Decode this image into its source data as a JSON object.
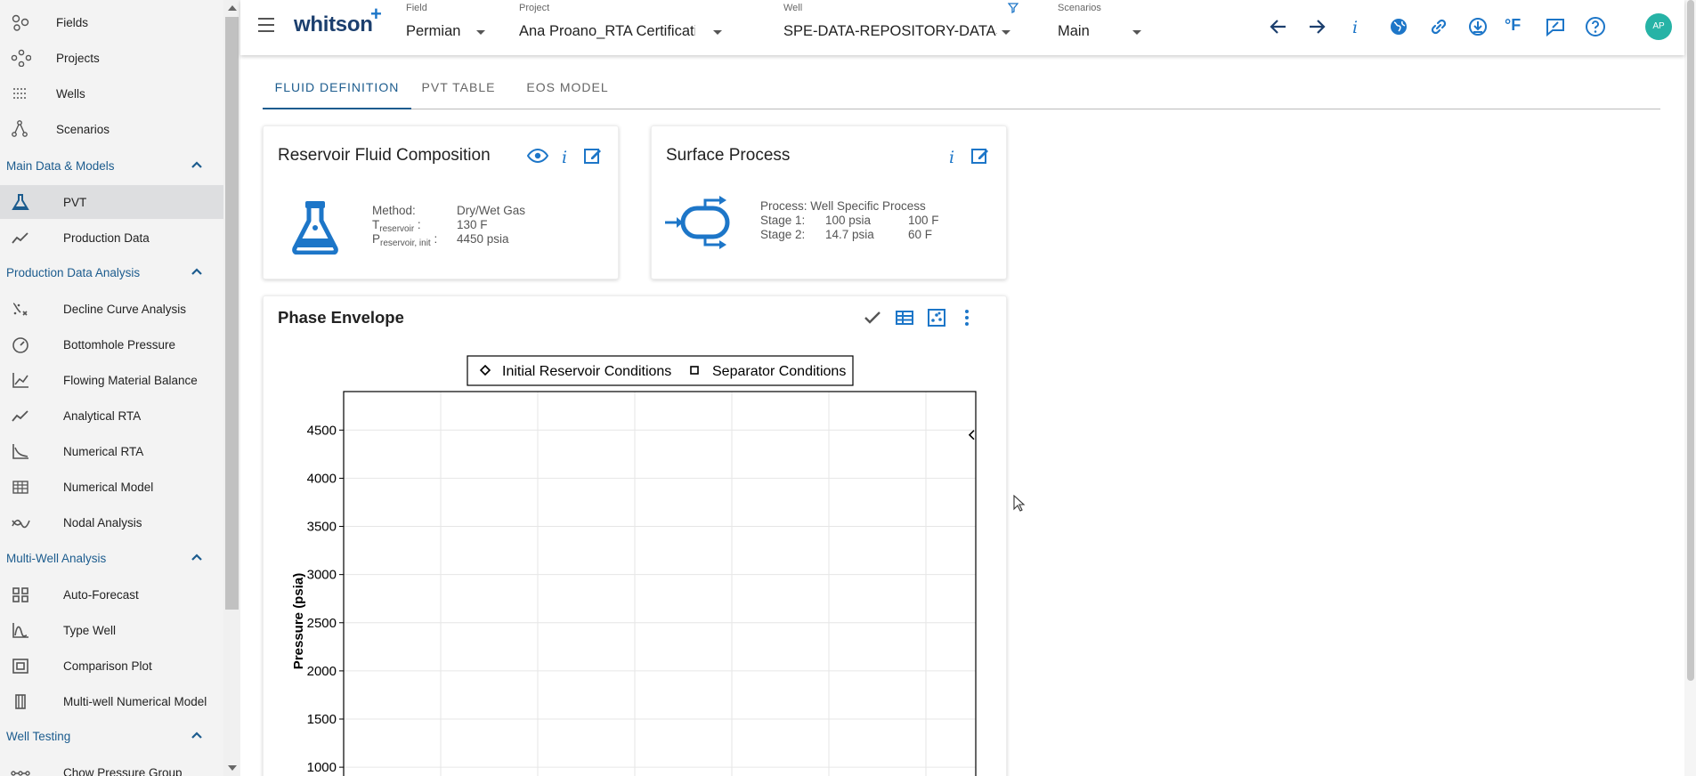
{
  "sidebar": {
    "top_items": [
      {
        "label": "Fields",
        "icon": "fields-icon"
      },
      {
        "label": "Projects",
        "icon": "projects-icon"
      },
      {
        "label": "Wells",
        "icon": "wells-icon"
      },
      {
        "label": "Scenarios",
        "icon": "scenarios-icon"
      }
    ],
    "sections": [
      {
        "label": "Main Data & Models",
        "items": [
          {
            "label": "PVT",
            "icon": "flask-icon",
            "active": true
          },
          {
            "label": "Production Data",
            "icon": "production-data-icon"
          }
        ]
      },
      {
        "label": "Production Data Analysis",
        "items": [
          {
            "label": "Decline Curve Analysis",
            "icon": "decline-curve-icon"
          },
          {
            "label": "Bottomhole Pressure",
            "icon": "gauge-icon"
          },
          {
            "label": "Flowing Material Balance",
            "icon": "material-balance-icon"
          },
          {
            "label": "Analytical RTA",
            "icon": "analytical-rta-icon"
          },
          {
            "label": "Numerical RTA",
            "icon": "numerical-rta-icon"
          },
          {
            "label": "Numerical Model",
            "icon": "numerical-model-icon"
          },
          {
            "label": "Nodal Analysis",
            "icon": "nodal-analysis-icon"
          }
        ]
      },
      {
        "label": "Multi-Well Analysis",
        "items": [
          {
            "label": "Auto-Forecast",
            "icon": "auto-forecast-icon"
          },
          {
            "label": "Type Well",
            "icon": "type-well-icon"
          },
          {
            "label": "Comparison Plot",
            "icon": "comparison-plot-icon"
          },
          {
            "label": "Multi-well Numerical Model",
            "icon": "multiwell-model-icon"
          }
        ]
      },
      {
        "label": "Well Testing",
        "items": [
          {
            "label": "Chow Pressure Group",
            "icon": "chow-pressure-icon"
          }
        ]
      }
    ]
  },
  "topbar": {
    "logo": "whitson",
    "logo_plus": "+",
    "field": {
      "caption": "Field",
      "value": "Permian"
    },
    "project": {
      "caption": "Project",
      "value": "Ana Proano_RTA Certification_Jan"
    },
    "well": {
      "caption": "Well",
      "value": "SPE-DATA-REPOSITORY-DATASET"
    },
    "scenarios": {
      "caption": "Scenarios",
      "value": "Main"
    },
    "unit_label": "°F",
    "avatar": "AP"
  },
  "tabs": [
    {
      "label": "FLUID DEFINITION",
      "active": true
    },
    {
      "label": "PVT TABLE",
      "active": false
    },
    {
      "label": "EOS MODEL",
      "active": false
    }
  ],
  "reservoir_card": {
    "title": "Reservoir Fluid Composition",
    "method_label": "Method:",
    "method_value": "Dry/Wet Gas",
    "t_label": "T",
    "t_sub": "reservoir",
    "t_colon": ":",
    "t_value": "130 F",
    "p_label": "P",
    "p_sub": "reservoir, init",
    "p_colon": ":",
    "p_value": "4450 psia"
  },
  "surface_card": {
    "title": "Surface Process",
    "process": "Process: Well Specific Process",
    "stage1_label": "Stage 1:",
    "stage1_p": "100 psia",
    "stage1_t": "100 F",
    "stage2_label": "Stage 2:",
    "stage2_p": "14.7 psia",
    "stage2_t": "60 F"
  },
  "phase_card": {
    "title": "Phase Envelope"
  },
  "chart_data": {
    "type": "scatter",
    "title": "",
    "xlabel": "",
    "ylabel": "Pressure (psia)",
    "ylim": [
      650,
      4900
    ],
    "y_ticks": [
      1000,
      1500,
      2000,
      2500,
      3000,
      3500,
      4000,
      4500
    ],
    "grid": true,
    "legend_position": "top-center",
    "series": [
      {
        "name": "Initial Reservoir Conditions",
        "marker": "diamond",
        "points": [
          {
            "x": 130,
            "y": 4450
          }
        ]
      },
      {
        "name": "Separator Conditions",
        "marker": "square",
        "points": []
      }
    ],
    "colors": {
      "marker": "#000000",
      "grid": "#e6e6e6",
      "axis": "#000000"
    }
  },
  "colors": {
    "accent": "#1d76c8",
    "nav_section": "#1c5c8e",
    "avatar": "#26b3a6"
  }
}
